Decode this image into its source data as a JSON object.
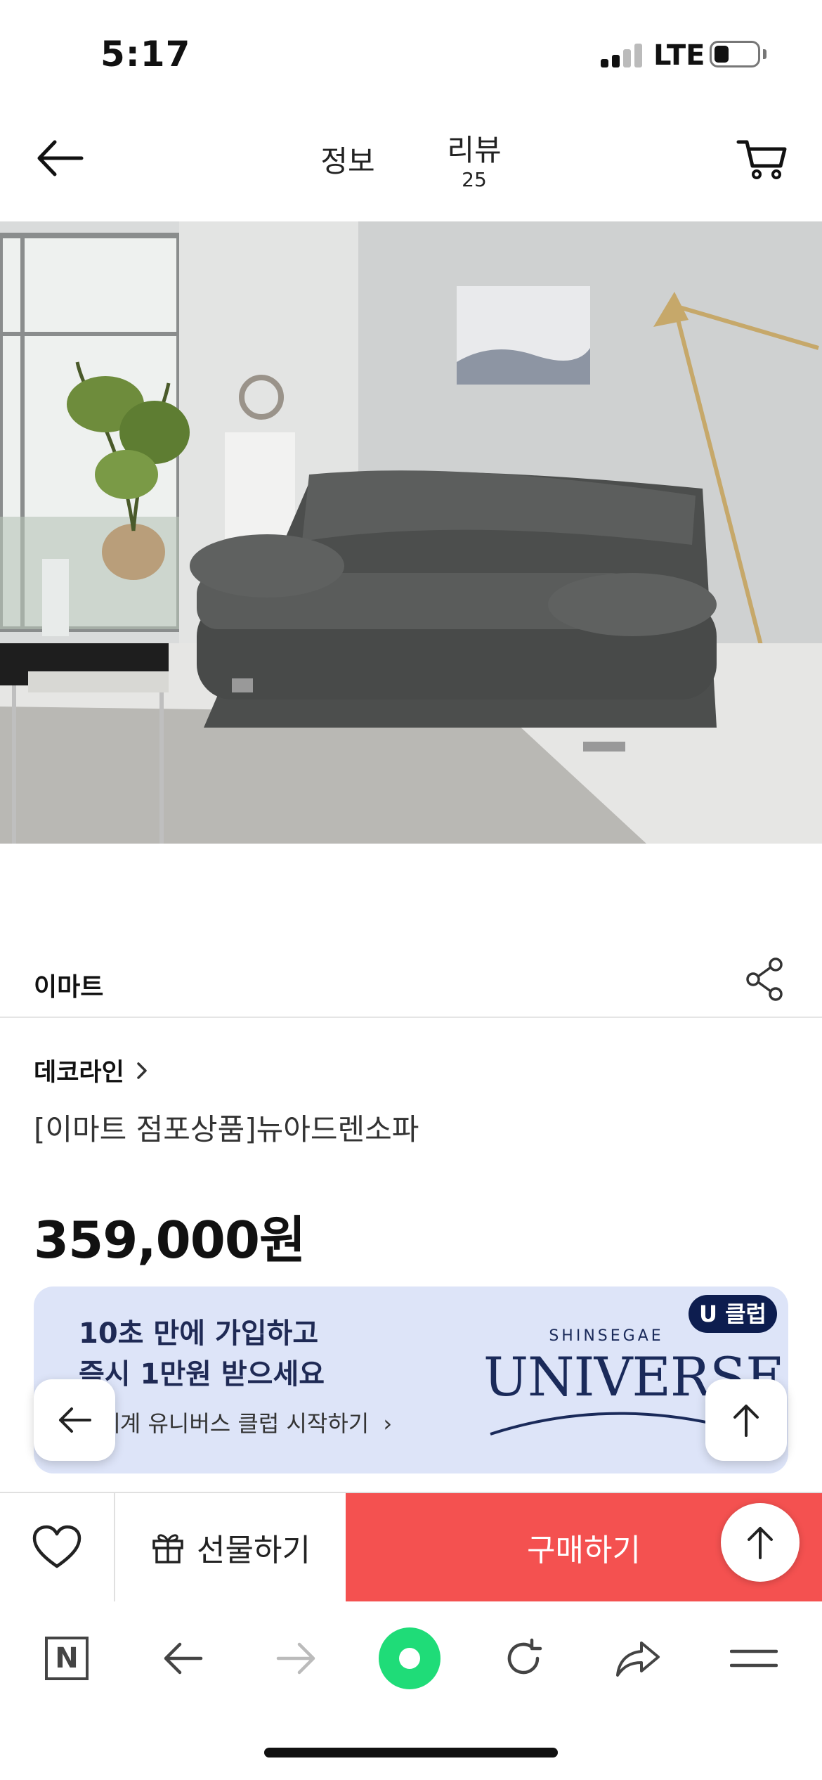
{
  "status": {
    "time": "5:17",
    "network": "LTE"
  },
  "nav": {
    "tab_info": "정보",
    "tab_review": "리뷰",
    "review_count": "25"
  },
  "seller": {
    "name": "이마트"
  },
  "product": {
    "brand": "데코라인",
    "name": "[이마트 점포상품]뉴아드렌소파",
    "price": "359,000원"
  },
  "banner": {
    "headline_1": "10초 만에 가입하고",
    "headline_2": "즉시 1만원 받으세요",
    "sub_text": "신세계 유니버스 클럽 시작하기",
    "badge": "U 클럽",
    "brand_small": "SHINSEGAE",
    "brand_large": "UNIVERSE",
    "bg_color": "#dde4f8"
  },
  "actions": {
    "gift_label": "선물하기",
    "buy_label": "구매하기",
    "buy_color": "#f45150"
  },
  "browser": {
    "home_icon": "N",
    "center_color": "#1fdc78"
  },
  "icons": [
    "back-arrow-icon",
    "cart-icon",
    "share-icon",
    "chevron-right-icon",
    "heart-icon",
    "gift-icon",
    "arrow-up-icon",
    "refresh-icon",
    "forward-icon",
    "menu-icon"
  ]
}
